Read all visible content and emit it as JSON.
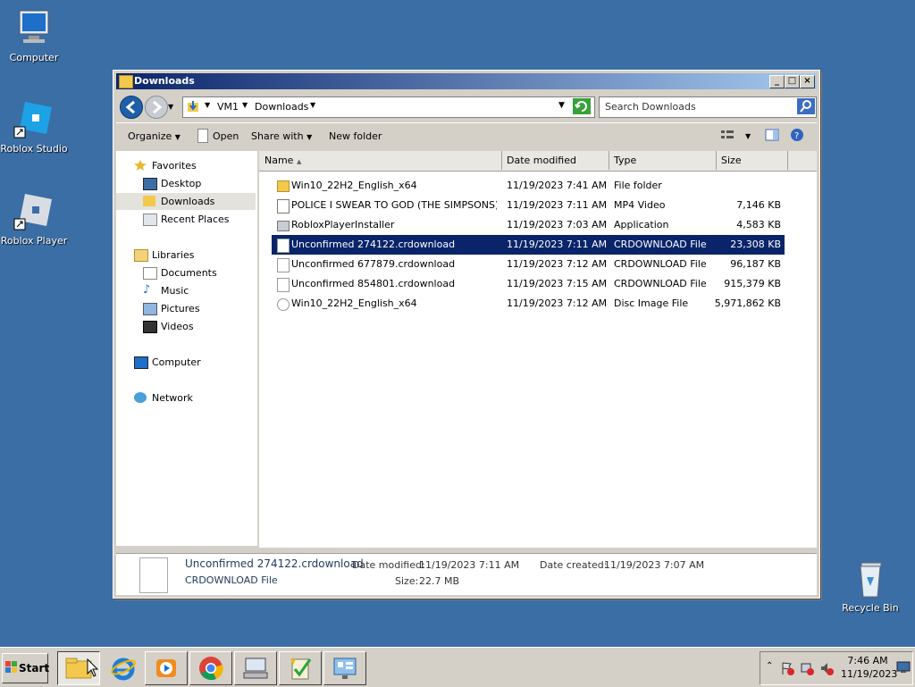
{
  "desktop": {
    "icons": [
      {
        "label": "Computer",
        "icon": "computer-icon"
      },
      {
        "label": "Roblox Studio",
        "icon": "roblox-studio-icon"
      },
      {
        "label": "Roblox Player",
        "icon": "roblox-player-icon"
      },
      {
        "label": "Recycle Bin",
        "icon": "recycle-bin-icon"
      }
    ]
  },
  "window": {
    "title": "Downloads",
    "buttons": {
      "minimize": "_",
      "maximize": "□",
      "close": "×"
    }
  },
  "address": {
    "crumbs": [
      "VM1",
      "Downloads"
    ],
    "search_placeholder": "Search Downloads"
  },
  "toolbar": {
    "organize": "Organize",
    "open": "Open",
    "share_with": "Share with",
    "new_folder": "New folder"
  },
  "nav": {
    "favorites": "Favorites",
    "desktop": "Desktop",
    "downloads": "Downloads",
    "recent_places": "Recent Places",
    "libraries": "Libraries",
    "documents": "Documents",
    "music": "Music",
    "pictures": "Pictures",
    "videos": "Videos",
    "computer": "Computer",
    "network": "Network"
  },
  "columns": {
    "name": "Name",
    "date": "Date modified",
    "type": "Type",
    "size": "Size"
  },
  "files": [
    {
      "name": "Win10_22H2_English_x64",
      "date": "11/19/2023 7:41 AM",
      "type": "File folder",
      "size": "",
      "icon": "folder-icon"
    },
    {
      "name": "POLICE I SWEAR TO GOD (THE SIMPSONS) ...",
      "date": "11/19/2023 7:11 AM",
      "type": "MP4 Video",
      "size": "7,146 KB",
      "icon": "video-file-icon"
    },
    {
      "name": "RobloxPlayerInstaller",
      "date": "11/19/2023 7:03 AM",
      "type": "Application",
      "size": "4,583 KB",
      "icon": "application-icon"
    },
    {
      "name": "Unconfirmed 274122.crdownload",
      "date": "11/19/2023 7:11 AM",
      "type": "CRDOWNLOAD File",
      "size": "23,308 KB",
      "icon": "file-icon",
      "selected": true
    },
    {
      "name": "Unconfirmed 677879.crdownload",
      "date": "11/19/2023 7:12 AM",
      "type": "CRDOWNLOAD File",
      "size": "96,187 KB",
      "icon": "file-icon"
    },
    {
      "name": "Unconfirmed 854801.crdownload",
      "date": "11/19/2023 7:15 AM",
      "type": "CRDOWNLOAD File",
      "size": "915,379 KB",
      "icon": "file-icon"
    },
    {
      "name": "Win10_22H2_English_x64",
      "date": "11/19/2023 7:12 AM",
      "type": "Disc Image File",
      "size": "5,971,862 KB",
      "icon": "disc-image-icon"
    }
  ],
  "details": {
    "name": "Unconfirmed 274122.crdownload",
    "type": "CRDOWNLOAD File",
    "date_modified_label": "Date modified:",
    "date_modified": "11/19/2023 7:11 AM",
    "date_created_label": "Date created:",
    "date_created": "11/19/2023 7:07 AM",
    "size_label": "Size:",
    "size": "22.7 MB"
  },
  "taskbar": {
    "start": "Start",
    "time": "7:46 AM",
    "date": "11/19/2023"
  }
}
